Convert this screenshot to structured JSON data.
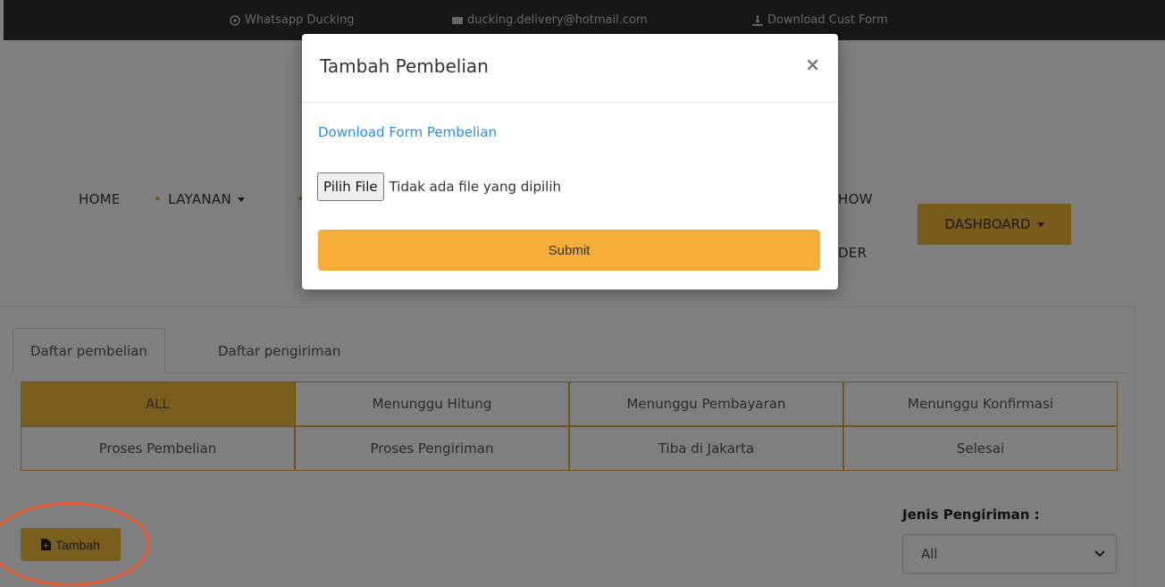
{
  "topbar": {
    "whatsapp": "Whatsapp Ducking",
    "email": "ducking.delivery@hotmail.com",
    "download": "Download Cust Form"
  },
  "nav": {
    "home": "HOME",
    "layanan": "LAYANAN",
    "how_partial": "HOW",
    "der_partial": "DER",
    "dashboard": "DASHBOARD"
  },
  "tabs": [
    "Daftar pembelian",
    "Daftar pengiriman"
  ],
  "filters": [
    "ALL",
    "Menunggu Hitung",
    "Menunggu Pembayaran",
    "Menunggu Konfirmasi",
    "Proses Pembelian",
    "Proses Pengiriman",
    "Tiba di Jakarta",
    "Selesai"
  ],
  "actions": {
    "tambah": "Tambah"
  },
  "jenis": {
    "label": "Jenis Pengiriman :",
    "selected": "All"
  },
  "modal": {
    "title": "Tambah Pembelian",
    "close": "×",
    "link": "Download Form Pembelian",
    "file_button": "Pilih File",
    "file_status": "Tidak ada file yang dipilih",
    "submit": "Submit"
  },
  "colors": {
    "accent": "#f5bd3c",
    "link": "#2f8fe6",
    "highlight": "#e8572f"
  }
}
